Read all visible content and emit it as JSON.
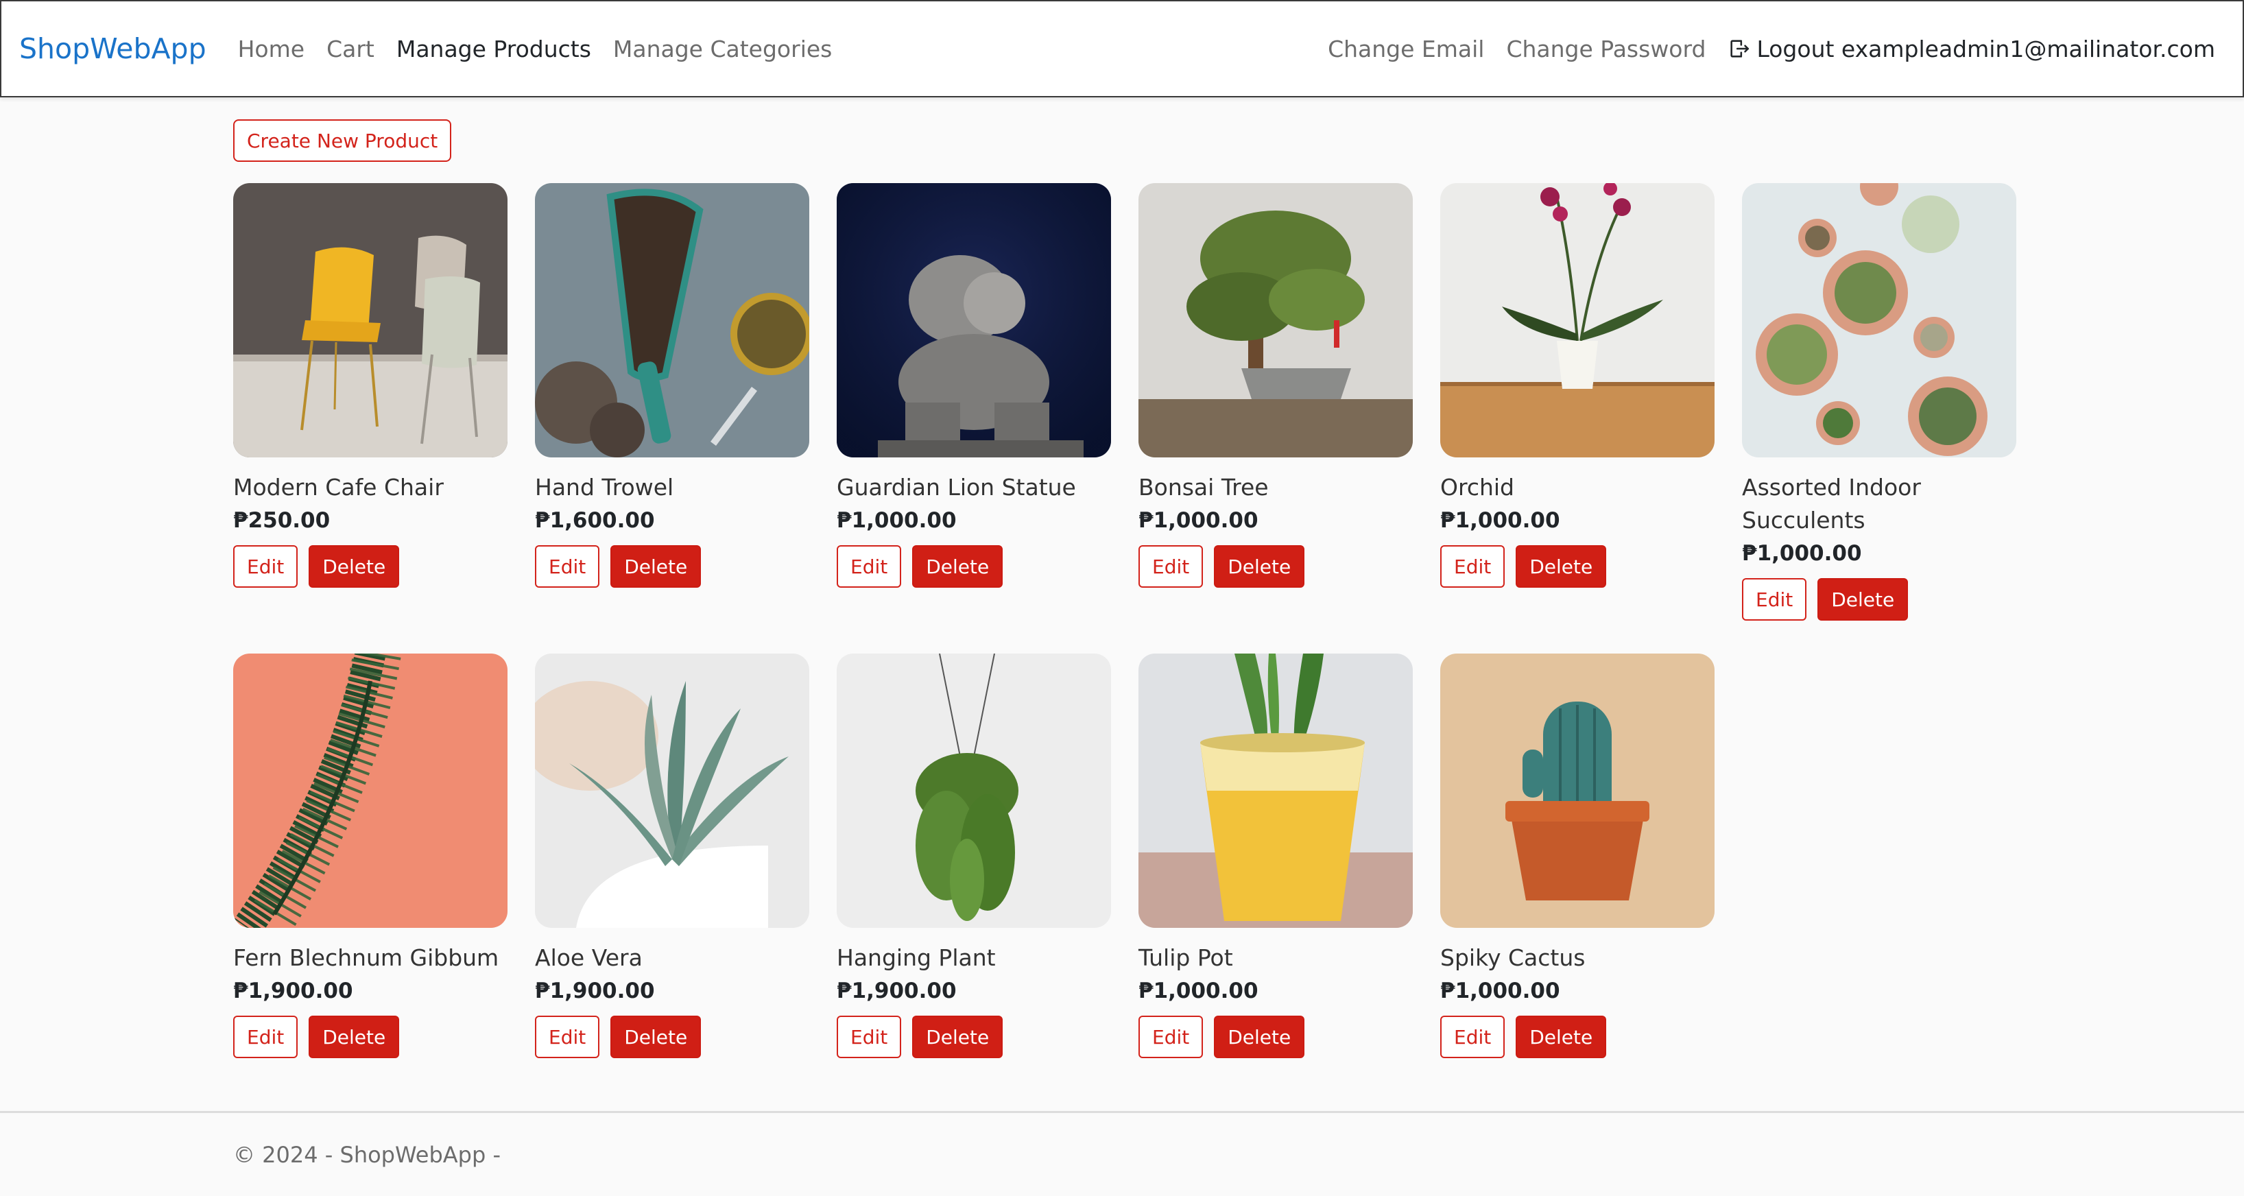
{
  "nav": {
    "brand": "ShopWebApp",
    "left": [
      {
        "label": "Home",
        "name": "nav-home",
        "active": false
      },
      {
        "label": "Cart",
        "name": "nav-cart",
        "active": false
      },
      {
        "label": "Manage Products",
        "name": "nav-manage-products",
        "active": true
      },
      {
        "label": "Manage Categories",
        "name": "nav-manage-categories",
        "active": false
      }
    ],
    "right": {
      "change_email": "Change Email",
      "change_password": "Change Password",
      "logout": "Logout exampleadmin1@mailinator.com",
      "logout_icon": "logout-icon"
    }
  },
  "create_button": "Create New Product",
  "edit_label": "Edit",
  "delete_label": "Delete",
  "products": [
    {
      "name": "Modern Cafe Chair",
      "price": "₱250.00",
      "image": "chair"
    },
    {
      "name": "Hand Trowel",
      "price": "₱1,600.00",
      "image": "trowel"
    },
    {
      "name": "Guardian Lion Statue",
      "price": "₱1,000.00",
      "image": "lion"
    },
    {
      "name": "Bonsai Tree",
      "price": "₱1,000.00",
      "image": "bonsai"
    },
    {
      "name": "Orchid",
      "price": "₱1,000.00",
      "image": "orchid"
    },
    {
      "name": "Assorted Indoor Succulents",
      "price": "₱1,000.00",
      "image": "succulents"
    },
    {
      "name": "Fern Blechnum Gibbum",
      "price": "₱1,900.00",
      "image": "fern"
    },
    {
      "name": "Aloe Vera",
      "price": "₱1,900.00",
      "image": "aloe"
    },
    {
      "name": "Hanging Plant",
      "price": "₱1,900.00",
      "image": "hanging"
    },
    {
      "name": "Tulip Pot",
      "price": "₱1,000.00",
      "image": "tulip"
    },
    {
      "name": "Spiky Cactus",
      "price": "₱1,000.00",
      "image": "cactus"
    }
  ],
  "footer": "© 2024 - ShopWebApp -"
}
